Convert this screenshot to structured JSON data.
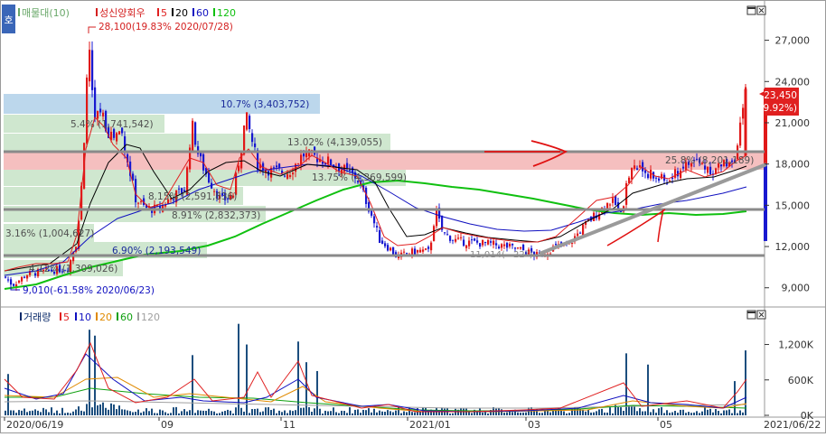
{
  "price_panel": {
    "legend": {
      "corner_label": "호",
      "items": [
        {
          "text": "매물대(10)",
          "color": "#6aa86a"
        },
        {
          "text": "성신양회우",
          "color": "#d42020"
        },
        {
          "text": "5",
          "color": "#e02020"
        },
        {
          "text": "20",
          "color": "#000000"
        },
        {
          "text": "60",
          "color": "#1010c0"
        },
        {
          "text": "120",
          "color": "#10c010"
        }
      ]
    },
    "price_tag": {
      "value": "23,450",
      "change": "( 29.92%)"
    },
    "annotations": {
      "high": "28,100(19.83% 2020/07/28)",
      "low": "9,010(-61.58% 2020/06/23)",
      "trend_angle": "11,014(",
      "trend_angle_rest": "22°)"
    },
    "volume_profile": [
      {
        "label": "10.7% (3,403,752)"
      },
      {
        "label": "5.4% (1,741,542)"
      },
      {
        "label": "13.02% (4,139,055)"
      },
      {
        "label": "25.8% (8,201,189)"
      },
      {
        "label": "13.75% (4,369,599)"
      },
      {
        "label": "8.15% (2,591,836)"
      },
      {
        "label": "8.91% (2,832,373)"
      },
      {
        "label": "3.16% (1,004,627)"
      },
      {
        "label": "6.90% (2,193,549)"
      },
      {
        "label": "4.12% (1,309,026)"
      }
    ]
  },
  "volume_panel": {
    "legend": [
      {
        "text": "거래량",
        "color": "#0a2a6a"
      },
      {
        "text": "5",
        "color": "#e02020"
      },
      {
        "text": "10",
        "color": "#1010c0"
      },
      {
        "text": "20",
        "color": "#e08a00"
      },
      {
        "text": "60",
        "color": "#10a010"
      },
      {
        "text": "120",
        "color": "#a0a0a0"
      }
    ]
  },
  "date_axis": {
    "labels": [
      "2020/06/19",
      "09",
      "11",
      "2021/01",
      "03",
      "05"
    ],
    "end_label": "2021/06/22"
  },
  "chart_data": {
    "type": "candlestick",
    "title": "성신양회우",
    "price_axis": {
      "ticks": [
        9000,
        12000,
        15000,
        18000,
        21000,
        24000,
        27000
      ],
      "tick_labels": [
        "9,000",
        "12,000",
        "15,000",
        "18,000",
        "21,000",
        "24,000",
        "27,000"
      ],
      "range": [
        7800,
        29600
      ]
    },
    "volume_axis": {
      "ticks": [
        0,
        600000,
        1200000
      ],
      "tick_labels": [
        "0K",
        "600K",
        "1,200K"
      ],
      "range": [
        0,
        1560000
      ]
    },
    "price_series": [
      {
        "date": "2020/06/19",
        "close": 9800
      },
      {
        "date": "2020/06/23",
        "low": 9010
      },
      {
        "date": "2020/07/28",
        "high": 28100
      },
      {
        "date": "2020/08",
        "close": 20000
      },
      {
        "date": "2020/09",
        "close": 14800
      },
      {
        "date": "2020/10",
        "close": 17500
      },
      {
        "date": "2020/11",
        "close": 18500
      },
      {
        "date": "2020/12",
        "close": 13200
      },
      {
        "date": "2021/01",
        "close": 12400
      },
      {
        "date": "2021/02",
        "close": 12200
      },
      {
        "date": "2021/03",
        "close": 11300
      },
      {
        "date": "2021/04",
        "close": 15000
      },
      {
        "date": "2021/05",
        "close": 17000
      },
      {
        "date": "2021/06/22",
        "close": 23450
      }
    ],
    "volume_profile_pct": [
      10.7,
      5.4,
      13.02,
      25.8,
      13.75,
      8.15,
      8.91,
      3.16,
      6.9,
      4.12
    ],
    "horizontal_levels": [
      18900,
      14400,
      11014
    ],
    "trendline": {
      "from": {
        "date": "2021/03",
        "price": 11014
      },
      "to": {
        "date": "2021/06/22",
        "price": 18000
      }
    },
    "moving_averages": [
      "5",
      "20",
      "60",
      "120"
    ],
    "grid": false,
    "legend_position": "top-left"
  }
}
